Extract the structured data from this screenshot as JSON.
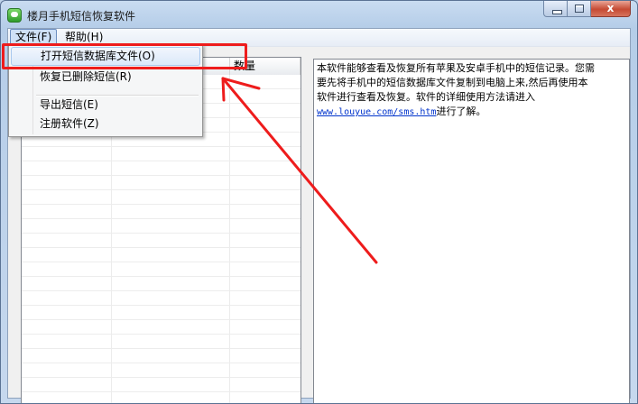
{
  "window": {
    "title": "楼月手机短信恢复软件",
    "caption_close": "x"
  },
  "menubar": {
    "file": "文件(F)",
    "help": "帮助(H)"
  },
  "file_menu": {
    "items": [
      {
        "label": "打开短信数据库文件(O)",
        "highlighted": true
      },
      {
        "label": "恢复已删除短信(R)"
      },
      {
        "label": "导出短信(E)"
      },
      {
        "label": "注册软件(Z)"
      }
    ]
  },
  "list": {
    "columns": [
      "",
      "",
      "数量"
    ]
  },
  "info": {
    "text_line1": "本软件能够查看及恢复所有苹果及安卓手机中的短信记录。您需",
    "text_line2": "要先将手机中的短信数据库文件复制到电脑上来,然后再使用本",
    "text_line3": "软件进行查看及恢复。软件的详细使用方法请进入",
    "link": "www.louyue.com/sms.htm",
    "link_suffix": "进行了解。"
  },
  "annotation": {
    "color": "#ee1c1c"
  }
}
